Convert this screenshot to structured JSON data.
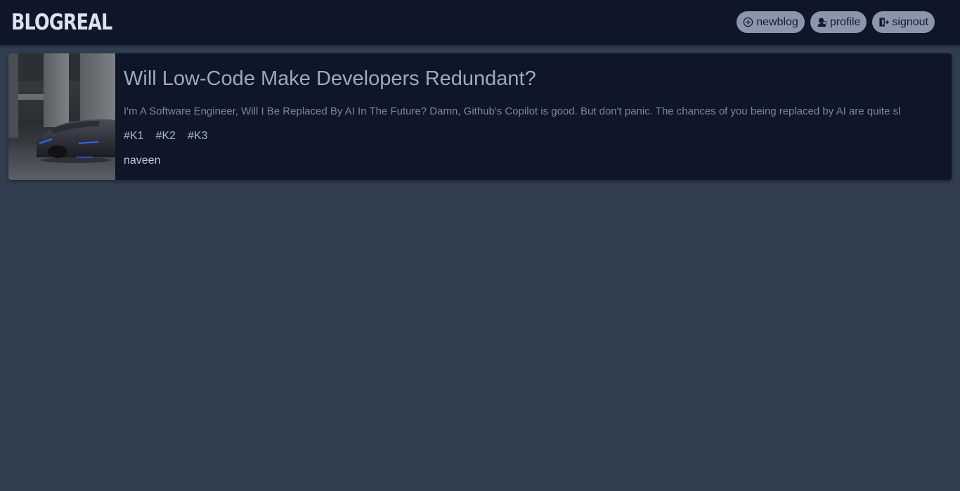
{
  "header": {
    "logo": "BLOGREAL",
    "nav": {
      "newblog_label": "newblog",
      "profile_label": "profile",
      "signout_label": "signout"
    }
  },
  "posts": [
    {
      "title": "Will Low-Code Make Developers Redundant?",
      "excerpt": "I'm A Software Engineer, Will I Be Replaced By AI In The Future? Damn, Github's Copilot is good. But don't panic. The chances of you being replaced by AI are quite sl",
      "tags": [
        "#K1",
        "#K2",
        "#K3"
      ],
      "author": "naveen",
      "image": "car-photo"
    }
  ],
  "colors": {
    "background": "#303e50",
    "header": "#0e1628",
    "card": "#0e1628",
    "pill": "#8a96ab",
    "title": "#9aaac3",
    "excerpt": "#7b88a0"
  }
}
